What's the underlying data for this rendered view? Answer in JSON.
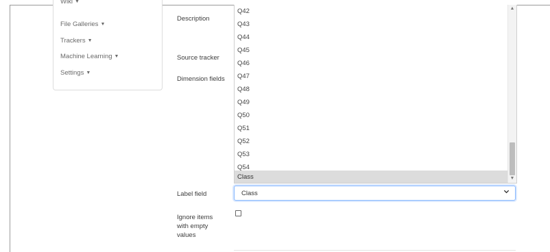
{
  "sidebar": {
    "items": [
      {
        "label": "Wiki"
      },
      {
        "label": "File Galleries"
      },
      {
        "label": "Trackers"
      },
      {
        "label": "Machine Learning"
      },
      {
        "label": "Settings"
      }
    ]
  },
  "form": {
    "description_label": "Description",
    "source_tracker_label": "Source tracker",
    "dimension_fields_label": "Dimension fields",
    "label_field_label": "Label field",
    "ignore_items_label_line1": "Ignore items",
    "ignore_items_label_line2": "with empty",
    "ignore_items_label_line3": "values",
    "dimension_options": [
      "Q42",
      "Q43",
      "Q44",
      "Q45",
      "Q46",
      "Q47",
      "Q48",
      "Q49",
      "Q50",
      "Q51",
      "Q52",
      "Q53",
      "Q54",
      "Class"
    ],
    "dimension_selected": "Class",
    "label_field_value": "Class",
    "ignore_items_checked": false
  },
  "icons": {
    "caret": "caret-down-icon",
    "chevron": "chevron-down-icon",
    "scroll_up": "scroll-up-arrow-icon",
    "scroll_down": "scroll-down-arrow-icon"
  }
}
